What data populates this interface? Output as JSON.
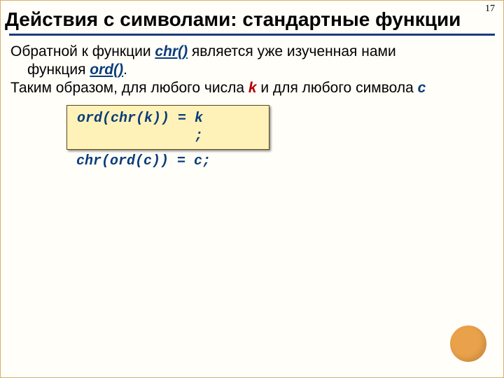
{
  "page_number": "17",
  "title": "Действия с символами: стандартные функции",
  "para1_part1": "Обратной к функции ",
  "para1_kw_chr": "chr()",
  "para1_part2": " является уже изученная нами",
  "para1_line2a": "функция ",
  "para1_kw_ord": "ord()",
  "para1_line2b": ".",
  "para2_part1": "Таким образом, для любого числа ",
  "para2_k": "k",
  "para2_part2": " и для любого символа ",
  "para2_c": "c",
  "code_line1": "ord(chr(k)) = k",
  "code_line2": "              ;",
  "code_after": "chr(ord(c)) = c;"
}
